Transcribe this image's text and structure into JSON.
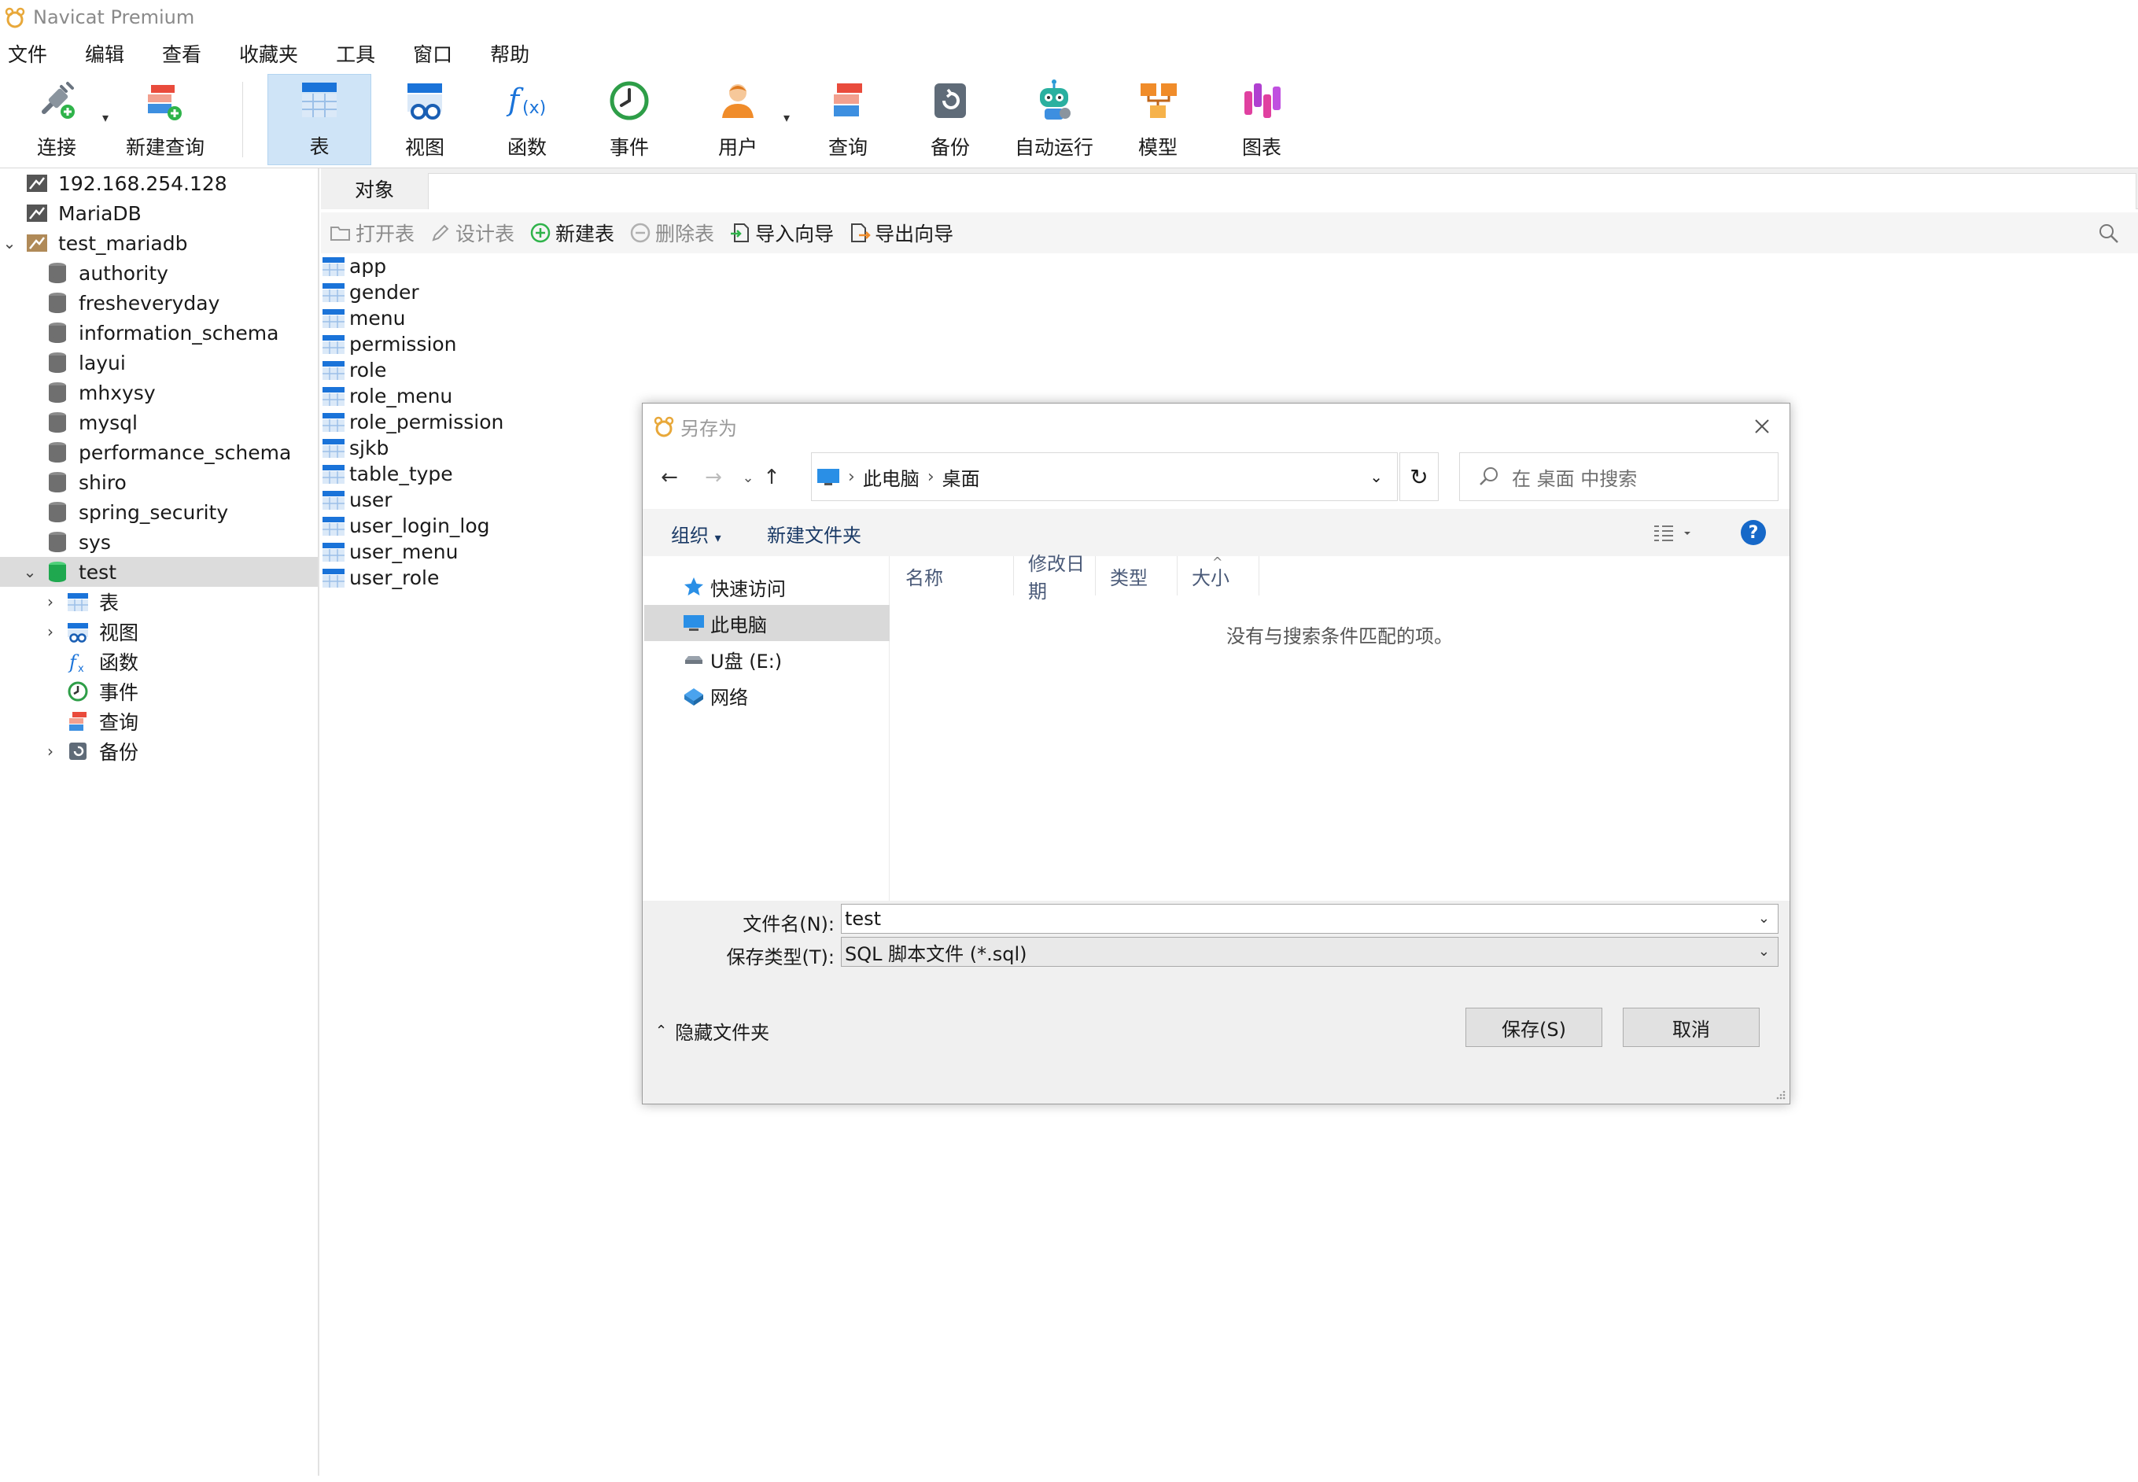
{
  "app": {
    "title": "Navicat Premium"
  },
  "menu": [
    "文件",
    "编辑",
    "查看",
    "收藏夹",
    "工具",
    "窗口",
    "帮助"
  ],
  "toolbar": {
    "connect": "连接",
    "new_query": "新建查询",
    "table": "表",
    "view": "视图",
    "function": "函数",
    "event": "事件",
    "user": "用户",
    "query": "查询",
    "backup": "备份",
    "automation": "自动运行",
    "model": "模型",
    "chart": "图表"
  },
  "tree": {
    "connections": [
      "192.168.254.128",
      "MariaDB",
      "test_mariadb"
    ],
    "databases": [
      "authority",
      "fresheveryday",
      "information_schema",
      "layui",
      "mhxysy",
      "mysql",
      "performance_schema",
      "shiro",
      "spring_security",
      "sys",
      "test"
    ],
    "test_children": [
      "表",
      "视图",
      "函数",
      "事件",
      "查询",
      "备份"
    ]
  },
  "objects": {
    "tab": "对象",
    "toolbar": {
      "open_table": "打开表",
      "design_table": "设计表",
      "new_table": "新建表",
      "delete_table": "删除表",
      "import_wizard": "导入向导",
      "export_wizard": "导出向导"
    },
    "tables": [
      "app",
      "gender",
      "menu",
      "permission",
      "role",
      "role_menu",
      "role_permission",
      "sjkb",
      "table_type",
      "user",
      "user_login_log",
      "user_menu",
      "user_role"
    ]
  },
  "dialog": {
    "title": "另存为",
    "breadcrumb": [
      "此电脑",
      "桌面"
    ],
    "search_placeholder": "在 桌面 中搜索",
    "organize": "组织",
    "new_folder": "新建文件夹",
    "help": "?",
    "sidebar": [
      "快速访问",
      "此电脑",
      "U盘 (E:)",
      "网络"
    ],
    "columns": [
      "名称",
      "修改日期",
      "类型",
      "大小"
    ],
    "empty_message": "没有与搜索条件匹配的项。",
    "filename_label": "文件名(N):",
    "filename_value": "test",
    "filetype_label": "保存类型(T):",
    "filetype_value": "SQL 脚本文件 (*.sql)",
    "hide_folders": "隐藏文件夹",
    "save": "保存(S)",
    "cancel": "取消"
  },
  "colors": {
    "accent": "#1668c8",
    "selection": "#cfe4f7",
    "tree_selected": "#dcdcdc"
  }
}
